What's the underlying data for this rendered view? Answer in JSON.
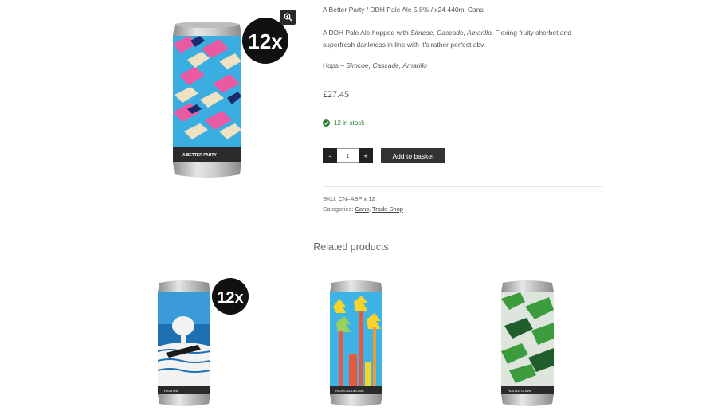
{
  "product": {
    "short_title": "A Better Party / DDH Pale Ale 5.8% / x24 440ml Cans",
    "desc_prefix": "A DDH Pale Ale hopped with ",
    "desc_hops": "Simcoe, Cascade, Amarillo",
    "desc_suffix": ". Flexing fruity sherbet and superfresh dankness in line with it's rather perfect abv.",
    "hops_label": "Hops – ",
    "hops_value": "Simcoe, Cascade, Amarillo",
    "price": "£27.45",
    "stock": "12 in stock",
    "qty_minus": "-",
    "qty_plus": "+",
    "qty_value": "1",
    "add_to_basket": "Add to basket",
    "sku_label": "SKU: ",
    "sku_value": "CN–ABP x 12",
    "categories_label": "Categories: ",
    "category_1": "Cans",
    "category_sep": ", ",
    "category_2": "Trade Shop",
    "badge_text": "12x",
    "can_label": "A BETTER PARTY",
    "can_sub": "DDH PALE ALE · SIMCOE CASCADE AMARILLO · 5.8%"
  },
  "related": {
    "title": "Related products",
    "items": [
      {
        "can_label": "HIGH IPA",
        "badge": "12x"
      },
      {
        "can_label": "TROPICAL DELUXE",
        "badge": ""
      },
      {
        "can_label": "HUSTLE DOWN",
        "badge": ""
      }
    ]
  },
  "icons": {
    "zoom": "magnifier-plus-icon",
    "stock": "check-circle-icon"
  },
  "colors": {
    "in_stock": "#2e7d32",
    "button_dark": "#333333",
    "badge": "#111111"
  }
}
